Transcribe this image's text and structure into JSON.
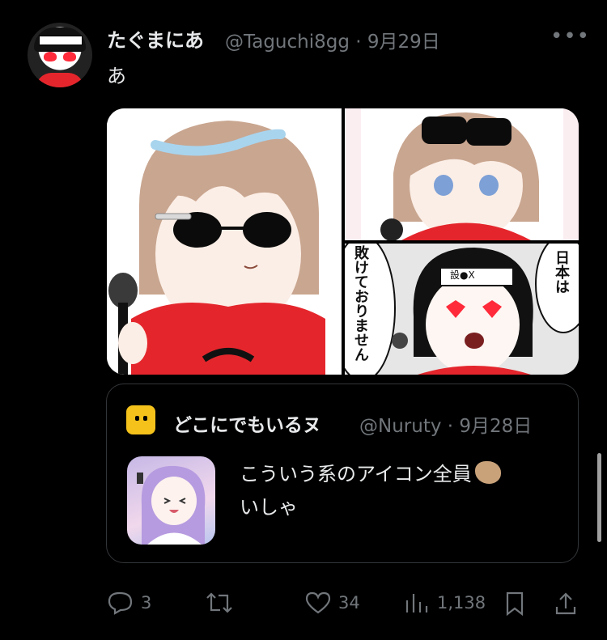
{
  "tweet": {
    "author_name": "たぐまにあ",
    "handle_time": "@Taguchi8gg · 9月29日",
    "text": "あ",
    "more_icon": "more-dots-icon"
  },
  "media": {
    "panel3_text_right": "日本は",
    "panel3_text_left": "敗けておりません",
    "headband_text": "設●X"
  },
  "quote": {
    "author_name": "どこにでもいるヌ",
    "handle_time": "@Nuruty · 9月28日",
    "text_line1": "こういう系のアイコン全員",
    "text_line2": "いしゃ"
  },
  "actions": {
    "replies": "3",
    "retweets": "",
    "likes": "34",
    "views": "1,138"
  },
  "colors": {
    "background": "#000000",
    "text": "#e7e9ea",
    "muted": "#71767b",
    "border": "#333639",
    "accent_red": "#e4262c"
  }
}
